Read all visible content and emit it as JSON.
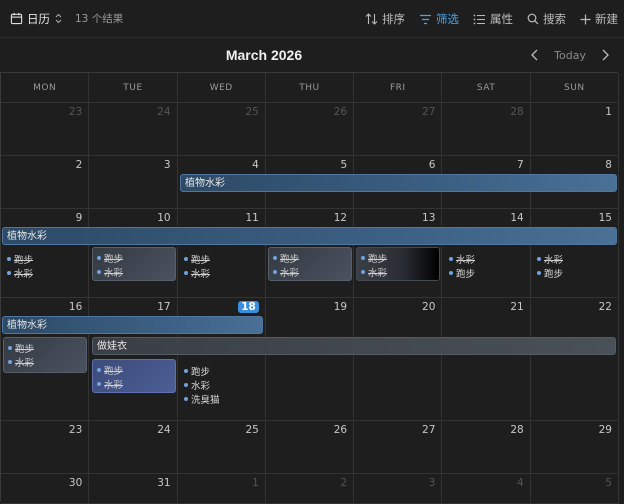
{
  "toolbar": {
    "view_label": "日历",
    "result_count": "13 个结果",
    "sort_label": "排序",
    "filter_label": "筛选",
    "props_label": "属性",
    "search_label": "搜索",
    "new_label": "新建"
  },
  "header": {
    "month_title": "March 2026",
    "today_label": "Today"
  },
  "weekdays": [
    "MON",
    "TUE",
    "WED",
    "THU",
    "FRI",
    "SAT",
    "SUN"
  ],
  "weeks": [
    [
      "23",
      "24",
      "25",
      "26",
      "27",
      "28",
      "1"
    ],
    [
      "2",
      "3",
      "4",
      "5",
      "6",
      "7",
      "8"
    ],
    [
      "9",
      "10",
      "11",
      "12",
      "13",
      "14",
      "15"
    ],
    [
      "16",
      "17",
      "18",
      "19",
      "20",
      "21",
      "22"
    ],
    [
      "23",
      "24",
      "25",
      "26",
      "27",
      "28",
      "29"
    ],
    [
      "30",
      "31",
      "1",
      "2",
      "3",
      "4",
      "5"
    ]
  ],
  "events": {
    "watercolor_plants": "植物水彩",
    "make_doll_clothes": "做娃衣",
    "run": "跑步",
    "watercolor": "水彩",
    "wash_cat": "洗臭猫"
  },
  "colors": {
    "accent": "#3b8ede",
    "dot": "#6fa3e0",
    "bar_blue": "#3b5f83"
  }
}
